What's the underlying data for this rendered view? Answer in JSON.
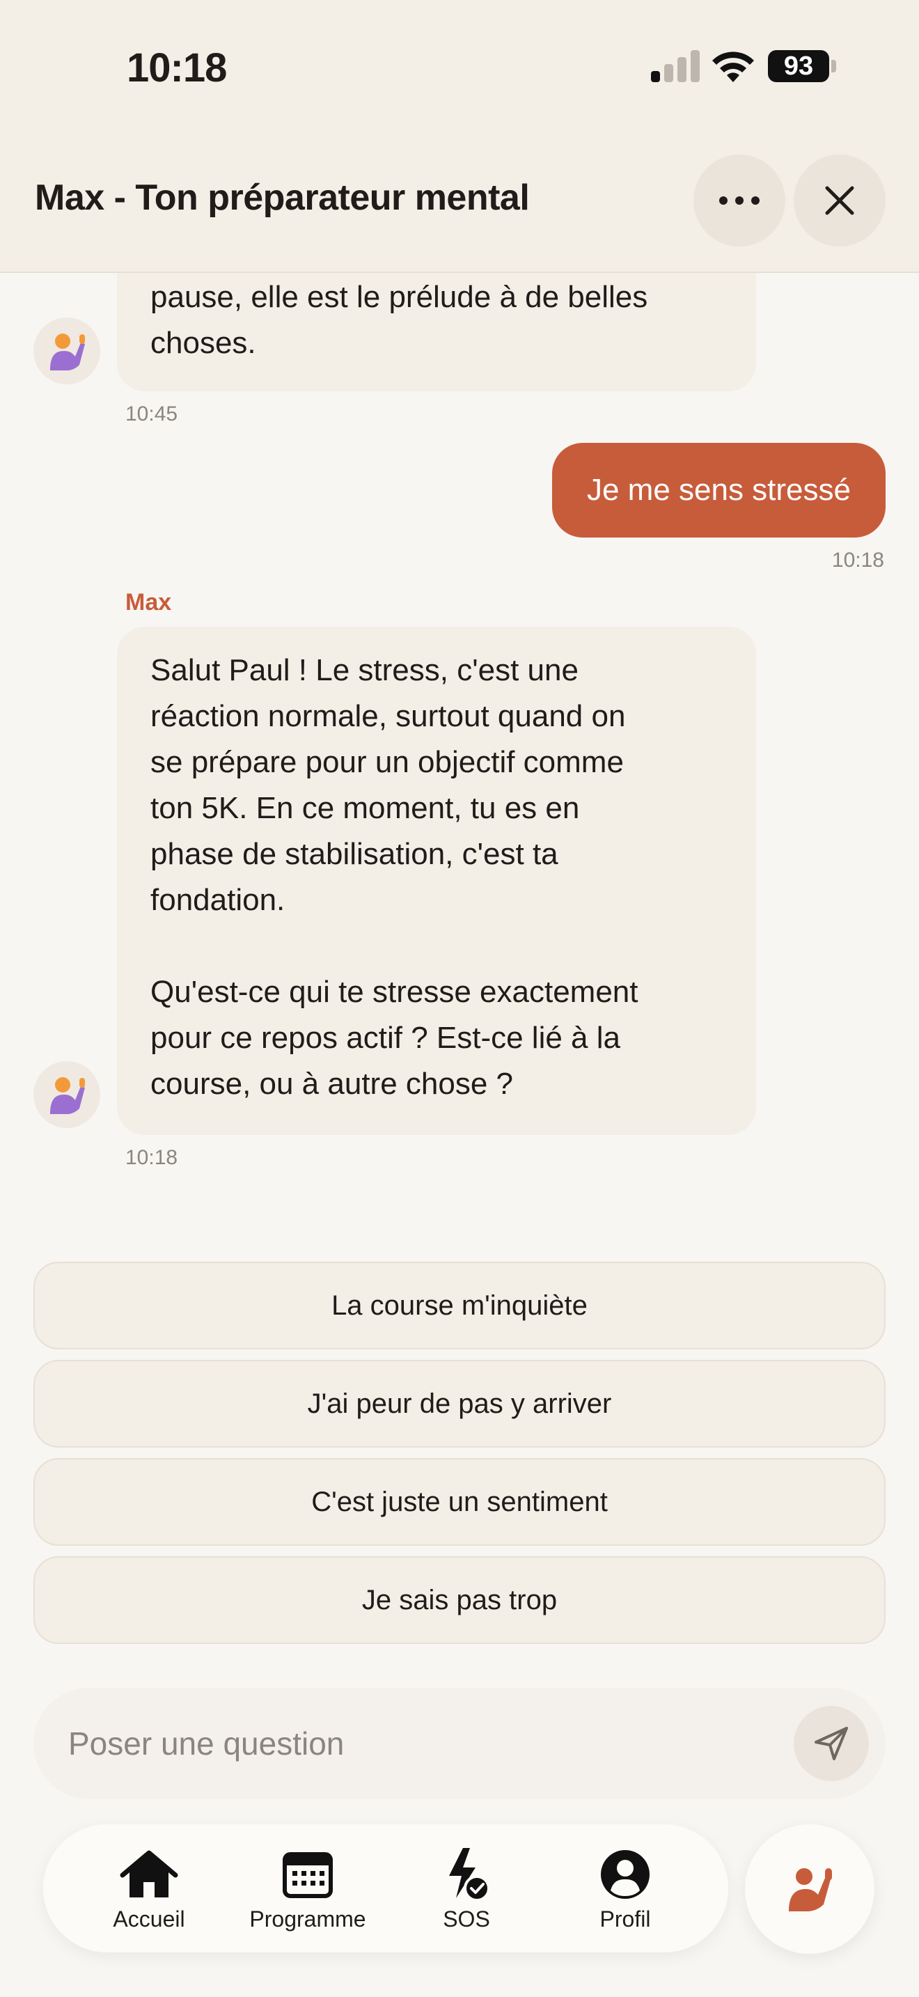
{
  "status_bar": {
    "time": "10:18",
    "battery": "93"
  },
  "header": {
    "title": "Max - Ton préparateur mental"
  },
  "messages": [
    {
      "from": "bot",
      "text": "pause, elle est le prélude à de belles\nchoses.",
      "time": "10:45"
    },
    {
      "from": "user",
      "text": "Je me sens stressé",
      "time": "10:18"
    },
    {
      "from": "bot",
      "sender": "Max",
      "text": "Salut Paul ! Le stress, c'est une\nréaction normale, surtout quand on\nse prépare pour un objectif comme\nton 5K. En ce moment, tu es en\nphase de stabilisation, c'est ta\nfondation.\n\nQu'est-ce qui te stresse exactement\npour ce repos actif ? Est-ce lié à la\ncourse, ou à autre chose ?",
      "time": "10:18"
    }
  ],
  "quick_replies": [
    "La course m'inquiète",
    "J'ai peur de pas y arriver",
    "C'est juste un sentiment",
    "Je sais pas trop"
  ],
  "composer": {
    "placeholder": "Poser une question",
    "value": ""
  },
  "tabs": [
    {
      "label": "Accueil",
      "icon": "home-icon"
    },
    {
      "label": "Programme",
      "icon": "calendar-icon"
    },
    {
      "label": "SOS",
      "icon": "sos-bolt-icon"
    },
    {
      "label": "Profil",
      "icon": "profile-icon"
    }
  ],
  "colors": {
    "accent": "#c75c3b",
    "bubble": "#f3eee6",
    "header_bg": "#f3eee6"
  }
}
